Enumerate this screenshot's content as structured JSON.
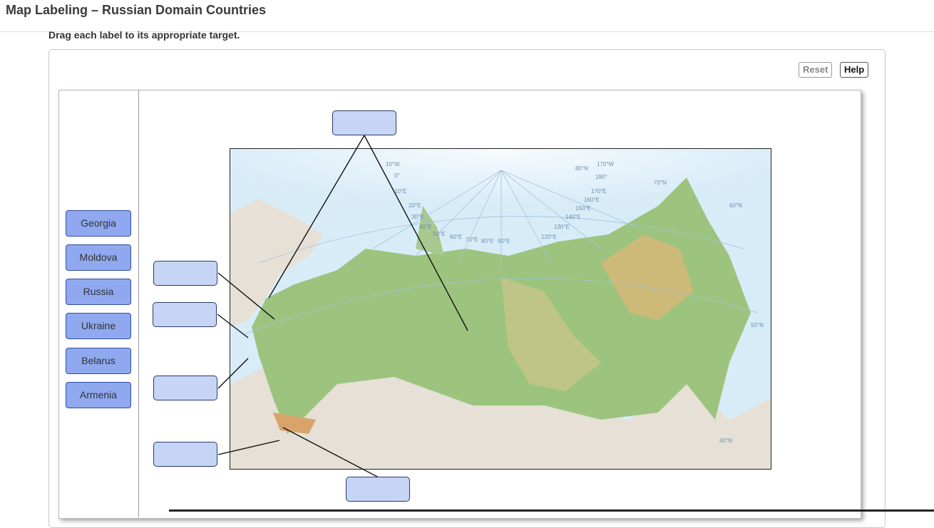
{
  "header": {
    "title": "Map Labeling – Russian Domain Countries"
  },
  "instructions": "Drag each label to its appropriate target.",
  "toolbar": {
    "reset_label": "Reset",
    "help_label": "Help"
  },
  "labels": [
    "Georgia",
    "Moldova",
    "Russia",
    "Ukraine",
    "Belarus",
    "Armenia"
  ],
  "map": {
    "graticule_labels": [
      "10°W",
      "0°",
      "10°E",
      "20°E",
      "30°E",
      "40°E",
      "50°E",
      "60°E",
      "70°E",
      "80°E",
      "90°E",
      "120°E",
      "130°E",
      "140°E",
      "150°E",
      "160°E",
      "170°E",
      "180°",
      "170°W",
      "40°N",
      "50°N",
      "60°N",
      "70°N",
      "80°N"
    ],
    "colors": {
      "water": "#d8ecf8",
      "lowland": "#9cc47f",
      "highland": "#d9b777",
      "foreign_land": "#e6e0d6",
      "ice": "#ffffff"
    }
  }
}
